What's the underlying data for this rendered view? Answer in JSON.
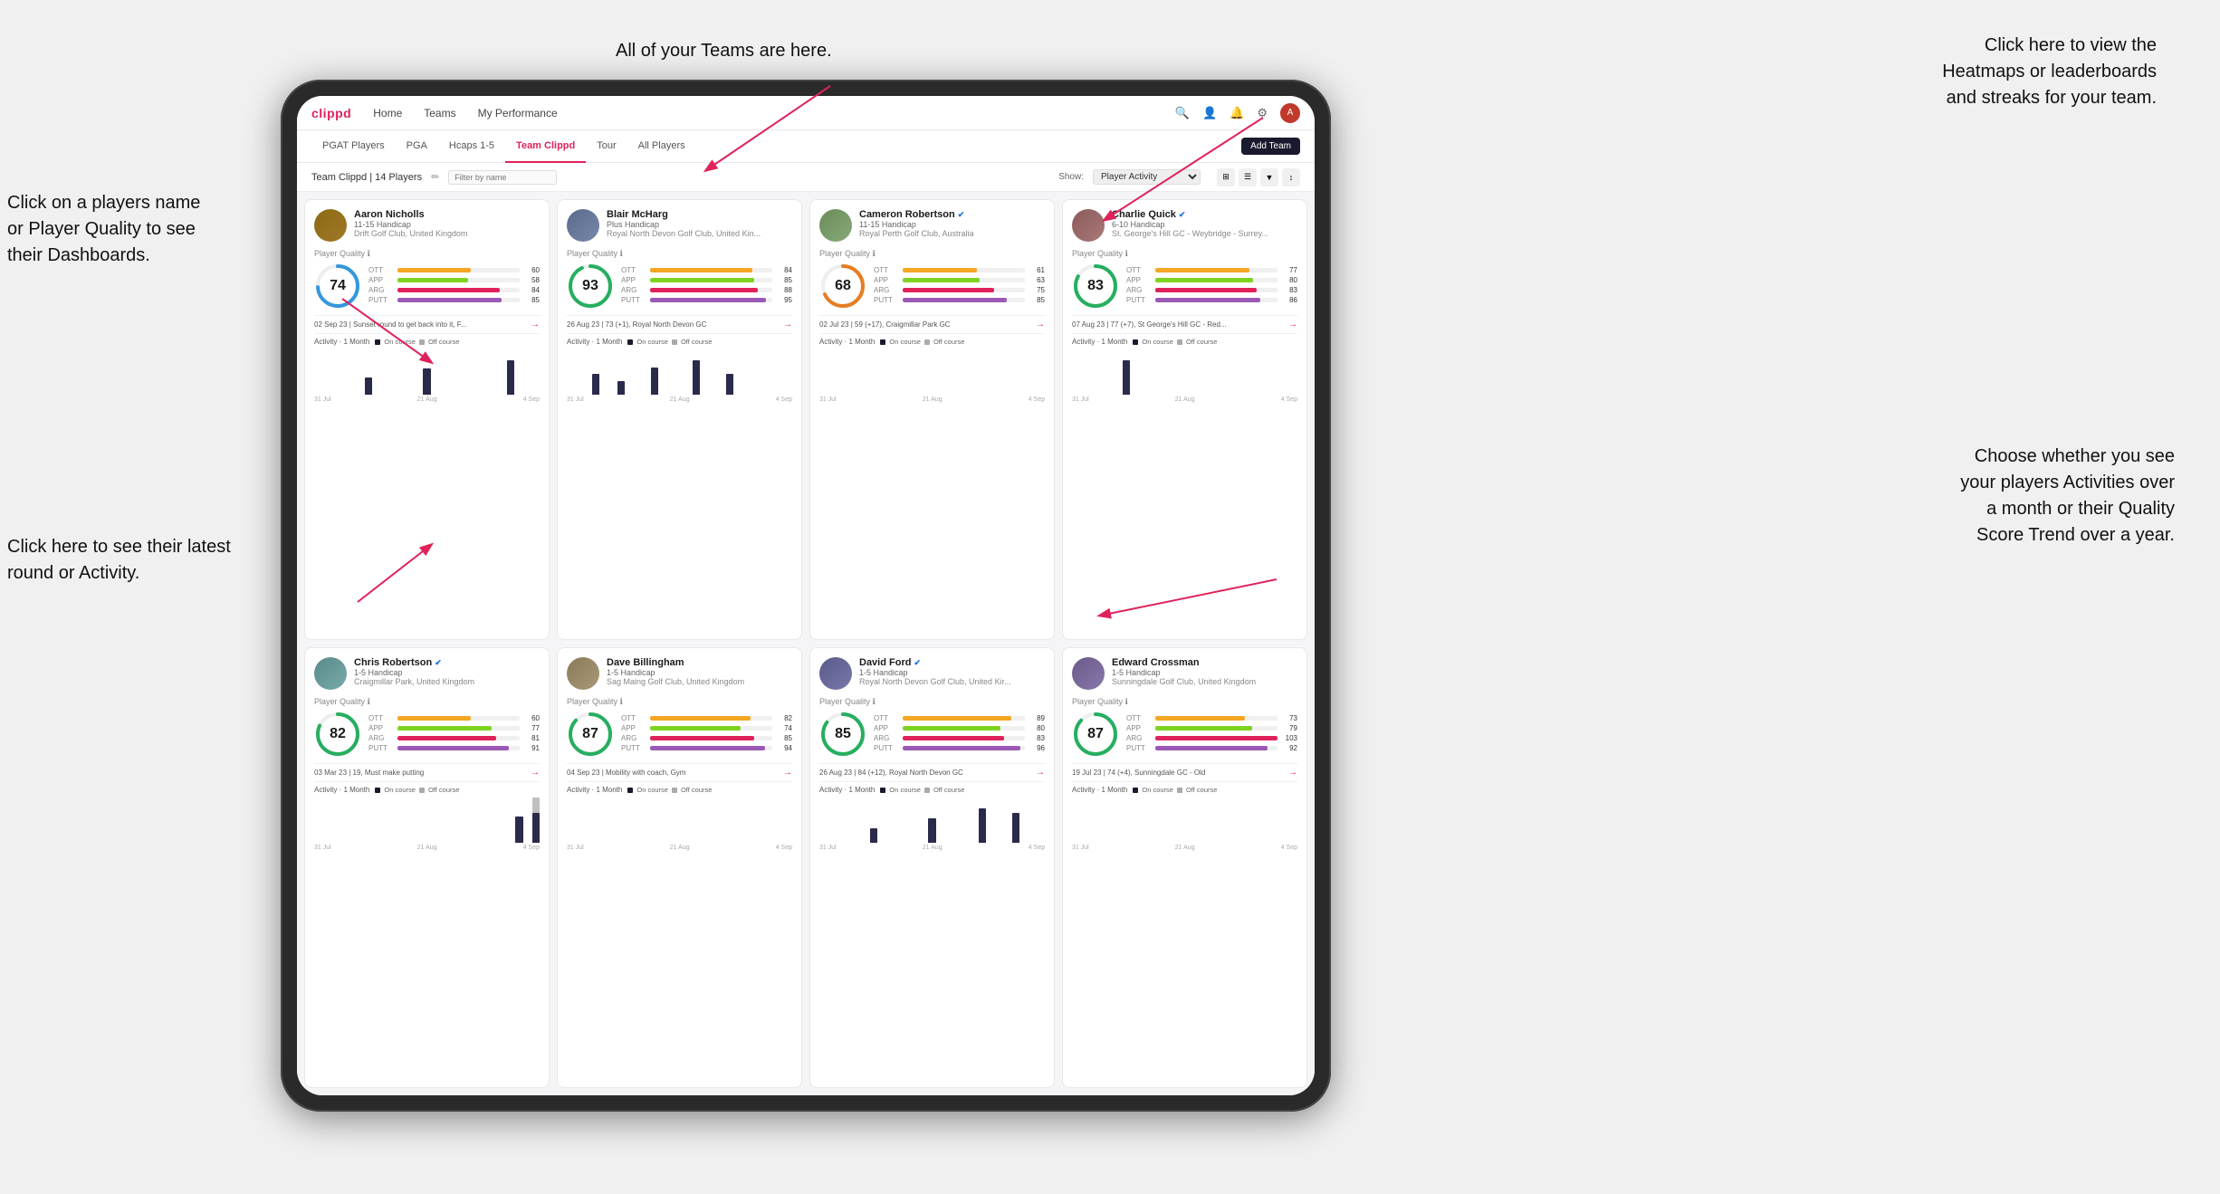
{
  "annotations": {
    "teams_tooltip": "All of your Teams are here.",
    "heatmaps_tooltip": "Click here to view the\nHeatmaps or leaderboards\nand streaks for your team.",
    "players_tooltip": "Click on a players name\nor Player Quality to see\ntheir Dashboards.",
    "round_tooltip": "Click here to see their latest\nround or Activity.",
    "activity_tooltip": "Choose whether you see\nyour players Activities over\na month or their Quality\nScore Trend over a year."
  },
  "nav": {
    "logo": "clippd",
    "links": [
      "Home",
      "Teams",
      "My Performance"
    ],
    "add_team": "Add Team"
  },
  "tabs": {
    "items": [
      "PGAT Players",
      "PGA",
      "Hcaps 1-5",
      "Team Clippd",
      "Tour",
      "All Players"
    ],
    "active": "Team Clippd"
  },
  "filter_bar": {
    "title": "Team Clippd | 14 Players",
    "search_placeholder": "Filter by name",
    "show_label": "Show:",
    "show_value": "Player Activity"
  },
  "players": [
    {
      "id": "aaron",
      "name": "Aaron Nicholls",
      "handicap": "11-15 Handicap",
      "club": "Drift Golf Club, United Kingdom",
      "verified": false,
      "quality": 74,
      "quality_color": "#3498db",
      "stats": {
        "OTT": {
          "value": 60,
          "pct": 60
        },
        "APP": {
          "value": 58,
          "pct": 58
        },
        "ARG": {
          "value": 84,
          "pct": 84
        },
        "PUTT": {
          "value": 85,
          "pct": 85
        }
      },
      "latest_round": "02 Sep 23 | Sunset round to get back into it, F...",
      "activity": {
        "label": "Activity · 1 Month",
        "bars": [
          0,
          0,
          0,
          0,
          0,
          0,
          2,
          0,
          0,
          0,
          0,
          0,
          0,
          3,
          0,
          0,
          0,
          0,
          0,
          0,
          0,
          0,
          0,
          4,
          0,
          0,
          0
        ],
        "off_bars": [
          0,
          0,
          0,
          0,
          0,
          0,
          0,
          0,
          0,
          0,
          0,
          0,
          0,
          0,
          0,
          0,
          0,
          0,
          0,
          0,
          0,
          0,
          0,
          0,
          0,
          0,
          0
        ],
        "dates": [
          "31 Jul",
          "21 Aug",
          "4 Sep"
        ]
      },
      "avatar_class": "avatar-aaron"
    },
    {
      "id": "blair",
      "name": "Blair McHarg",
      "handicap": "Plus Handicap",
      "club": "Royal North Devon Golf Club, United Kin...",
      "verified": false,
      "quality": 93,
      "quality_color": "#27ae60",
      "stats": {
        "OTT": {
          "value": 84,
          "pct": 84
        },
        "APP": {
          "value": 85,
          "pct": 85
        },
        "ARG": {
          "value": 88,
          "pct": 88
        },
        "PUTT": {
          "value": 95,
          "pct": 95
        }
      },
      "latest_round": "26 Aug 23 | 73 (+1), Royal North Devon GC",
      "activity": {
        "label": "Activity · 1 Month",
        "bars": [
          0,
          0,
          0,
          3,
          0,
          0,
          2,
          0,
          0,
          0,
          4,
          0,
          0,
          0,
          0,
          5,
          0,
          0,
          0,
          3,
          0,
          0,
          0,
          0,
          0,
          0,
          0
        ],
        "off_bars": [
          0,
          0,
          0,
          0,
          0,
          0,
          0,
          0,
          0,
          0,
          0,
          0,
          0,
          0,
          0,
          0,
          0,
          0,
          0,
          0,
          0,
          0,
          0,
          0,
          0,
          0,
          0
        ],
        "dates": [
          "31 Jul",
          "21 Aug",
          "4 Sep"
        ]
      },
      "avatar_class": "avatar-blair"
    },
    {
      "id": "cameron",
      "name": "Cameron Robertson",
      "handicap": "11-15 Handicap",
      "club": "Royal Perth Golf Club, Australia",
      "verified": true,
      "quality": 68,
      "quality_color": "#e67e22",
      "stats": {
        "OTT": {
          "value": 61,
          "pct": 61
        },
        "APP": {
          "value": 63,
          "pct": 63
        },
        "ARG": {
          "value": 75,
          "pct": 75
        },
        "PUTT": {
          "value": 85,
          "pct": 85
        }
      },
      "latest_round": "02 Jul 23 | 59 (+17), Craigmillar Park GC",
      "activity": {
        "label": "Activity · 1 Month",
        "bars": [
          0,
          0,
          0,
          0,
          0,
          0,
          0,
          0,
          0,
          0,
          0,
          0,
          0,
          0,
          0,
          0,
          0,
          0,
          0,
          0,
          0,
          0,
          0,
          0,
          0,
          0,
          0
        ],
        "off_bars": [
          0,
          0,
          0,
          0,
          0,
          0,
          0,
          0,
          0,
          0,
          0,
          0,
          0,
          0,
          0,
          0,
          0,
          0,
          0,
          0,
          0,
          0,
          0,
          0,
          0,
          0,
          0
        ],
        "dates": [
          "31 Jul",
          "21 Aug",
          "4 Sep"
        ]
      },
      "avatar_class": "avatar-cameron"
    },
    {
      "id": "charlie",
      "name": "Charlie Quick",
      "handicap": "6-10 Handicap",
      "club": "St. George's Hill GC - Weybridge - Surrey...",
      "verified": true,
      "quality": 83,
      "quality_color": "#27ae60",
      "stats": {
        "OTT": {
          "value": 77,
          "pct": 77
        },
        "APP": {
          "value": 80,
          "pct": 80
        },
        "ARG": {
          "value": 83,
          "pct": 83
        },
        "PUTT": {
          "value": 86,
          "pct": 86
        }
      },
      "latest_round": "07 Aug 23 | 77 (+7), St George's Hill GC - Red...",
      "activity": {
        "label": "Activity · 1 Month",
        "bars": [
          0,
          0,
          0,
          0,
          0,
          0,
          3,
          0,
          0,
          0,
          0,
          0,
          0,
          0,
          0,
          0,
          0,
          0,
          0,
          0,
          0,
          0,
          0,
          0,
          0,
          0,
          0
        ],
        "off_bars": [
          0,
          0,
          0,
          0,
          0,
          0,
          0,
          0,
          0,
          0,
          0,
          0,
          0,
          0,
          0,
          0,
          0,
          0,
          0,
          0,
          0,
          0,
          0,
          0,
          0,
          0,
          0
        ],
        "dates": [
          "31 Jul",
          "21 Aug",
          "4 Sep"
        ]
      },
      "avatar_class": "avatar-charlie"
    },
    {
      "id": "chris",
      "name": "Chris Robertson",
      "handicap": "1-5 Handicap",
      "club": "Craigmillar Park, United Kingdom",
      "verified": true,
      "quality": 82,
      "quality_color": "#27ae60",
      "stats": {
        "OTT": {
          "value": 60,
          "pct": 60
        },
        "APP": {
          "value": 77,
          "pct": 77
        },
        "ARG": {
          "value": 81,
          "pct": 81
        },
        "PUTT": {
          "value": 91,
          "pct": 91
        }
      },
      "latest_round": "03 Mar 23 | 19, Must make putting",
      "activity": {
        "label": "Activity · 1 Month",
        "bars": [
          0,
          0,
          0,
          0,
          0,
          0,
          0,
          0,
          0,
          0,
          0,
          0,
          0,
          0,
          0,
          0,
          0,
          0,
          0,
          0,
          0,
          0,
          0,
          0,
          3,
          0,
          4
        ],
        "off_bars": [
          0,
          0,
          0,
          0,
          0,
          0,
          0,
          0,
          0,
          0,
          0,
          0,
          0,
          0,
          0,
          0,
          0,
          0,
          0,
          0,
          0,
          0,
          0,
          0,
          0,
          0,
          2
        ],
        "dates": [
          "31 Jul",
          "21 Aug",
          "4 Sep"
        ]
      },
      "avatar_class": "avatar-chris"
    },
    {
      "id": "dave",
      "name": "Dave Billingham",
      "handicap": "1-5 Handicap",
      "club": "Sag Maing Golf Club, United Kingdom",
      "verified": false,
      "quality": 87,
      "quality_color": "#27ae60",
      "stats": {
        "OTT": {
          "value": 82,
          "pct": 82
        },
        "APP": {
          "value": 74,
          "pct": 74
        },
        "ARG": {
          "value": 85,
          "pct": 85
        },
        "PUTT": {
          "value": 94,
          "pct": 94
        }
      },
      "latest_round": "04 Sep 23 | Mobility with coach, Gym",
      "activity": {
        "label": "Activity · 1 Month",
        "bars": [
          0,
          0,
          0,
          0,
          0,
          0,
          0,
          0,
          0,
          0,
          0,
          0,
          0,
          0,
          0,
          0,
          0,
          0,
          0,
          0,
          0,
          0,
          0,
          0,
          0,
          0,
          0
        ],
        "off_bars": [
          0,
          0,
          0,
          0,
          0,
          0,
          0,
          0,
          0,
          0,
          0,
          0,
          0,
          0,
          0,
          0,
          0,
          0,
          0,
          0,
          0,
          0,
          0,
          0,
          0,
          0,
          0
        ],
        "dates": [
          "31 Jul",
          "21 Aug",
          "4 Sep"
        ]
      },
      "avatar_class": "avatar-dave"
    },
    {
      "id": "david",
      "name": "David Ford",
      "handicap": "1-5 Handicap",
      "club": "Royal North Devon Golf Club, United Kir...",
      "verified": true,
      "quality": 85,
      "quality_color": "#27ae60",
      "stats": {
        "OTT": {
          "value": 89,
          "pct": 89
        },
        "APP": {
          "value": 80,
          "pct": 80
        },
        "ARG": {
          "value": 83,
          "pct": 83
        },
        "PUTT": {
          "value": 96,
          "pct": 96
        }
      },
      "latest_round": "26 Aug 23 | 84 (+12), Royal North Devon GC",
      "activity": {
        "label": "Activity · 1 Month",
        "bars": [
          0,
          0,
          0,
          0,
          0,
          0,
          3,
          0,
          0,
          0,
          0,
          0,
          0,
          5,
          0,
          0,
          0,
          0,
          0,
          7,
          0,
          0,
          0,
          6,
          0,
          0,
          0
        ],
        "off_bars": [
          0,
          0,
          0,
          0,
          0,
          0,
          0,
          0,
          0,
          0,
          0,
          0,
          0,
          0,
          0,
          0,
          0,
          0,
          0,
          0,
          0,
          0,
          0,
          0,
          0,
          0,
          0
        ],
        "dates": [
          "31 Jul",
          "21 Aug",
          "4 Sep"
        ]
      },
      "avatar_class": "avatar-david"
    },
    {
      "id": "edward",
      "name": "Edward Crossman",
      "handicap": "1-5 Handicap",
      "club": "Sunningdale Golf Club, United Kingdom",
      "verified": false,
      "quality": 87,
      "quality_color": "#27ae60",
      "stats": {
        "OTT": {
          "value": 73,
          "pct": 73
        },
        "APP": {
          "value": 79,
          "pct": 79
        },
        "ARG": {
          "value": 103,
          "pct": 100
        },
        "PUTT": {
          "value": 92,
          "pct": 92
        }
      },
      "latest_round": "19 Jul 23 | 74 (+4), Sunningdale GC - Old",
      "activity": {
        "label": "Activity · 1 Month",
        "bars": [
          0,
          0,
          0,
          0,
          0,
          0,
          0,
          0,
          0,
          0,
          0,
          0,
          0,
          0,
          0,
          0,
          0,
          0,
          0,
          0,
          0,
          0,
          0,
          0,
          0,
          0,
          0
        ],
        "off_bars": [
          0,
          0,
          0,
          0,
          0,
          0,
          0,
          0,
          0,
          0,
          0,
          0,
          0,
          0,
          0,
          0,
          0,
          0,
          0,
          0,
          0,
          0,
          0,
          0,
          0,
          0,
          0
        ],
        "dates": [
          "31 Jul",
          "21 Aug",
          "4 Sep"
        ]
      },
      "avatar_class": "avatar-edward"
    }
  ]
}
